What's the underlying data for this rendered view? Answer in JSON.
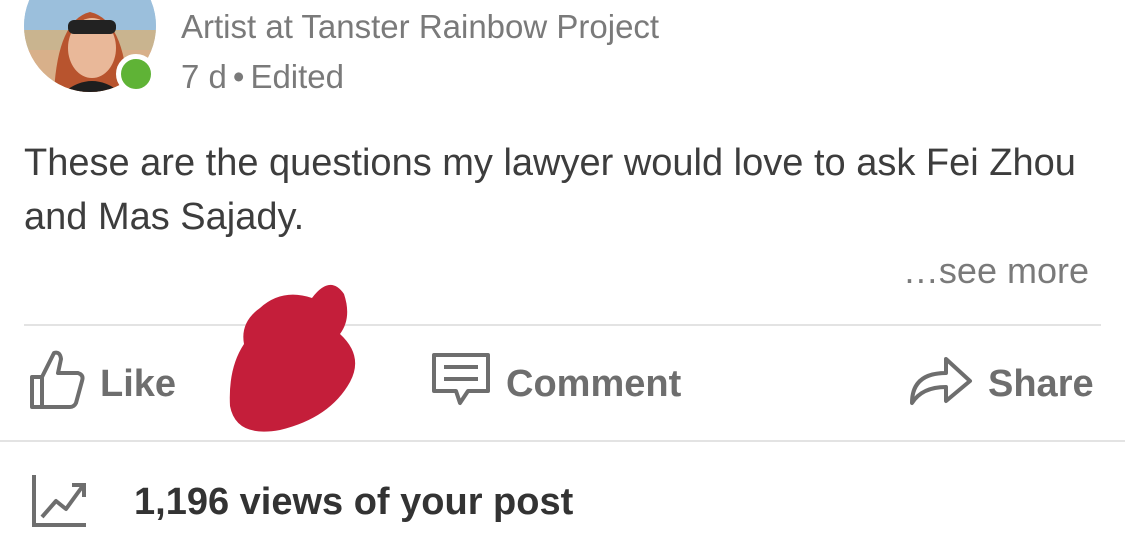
{
  "post": {
    "author_headline": "Artist at Tanster Rainbow Project",
    "age": "7 d",
    "separator": "•",
    "edited": "Edited",
    "text": "These are the questions my lawyer would love to ask Fei Zhou and Mas Sajady.",
    "see_more": "…see more"
  },
  "actions": {
    "like": "Like",
    "comment": "Comment",
    "share": "Share"
  },
  "analytics": {
    "views": "1,196 views of your post"
  },
  "colors": {
    "online": "#5fb336",
    "reaction_blob": "#c41e3a",
    "text_primary": "#3d3d3d",
    "text_secondary": "#7a7a7a"
  }
}
